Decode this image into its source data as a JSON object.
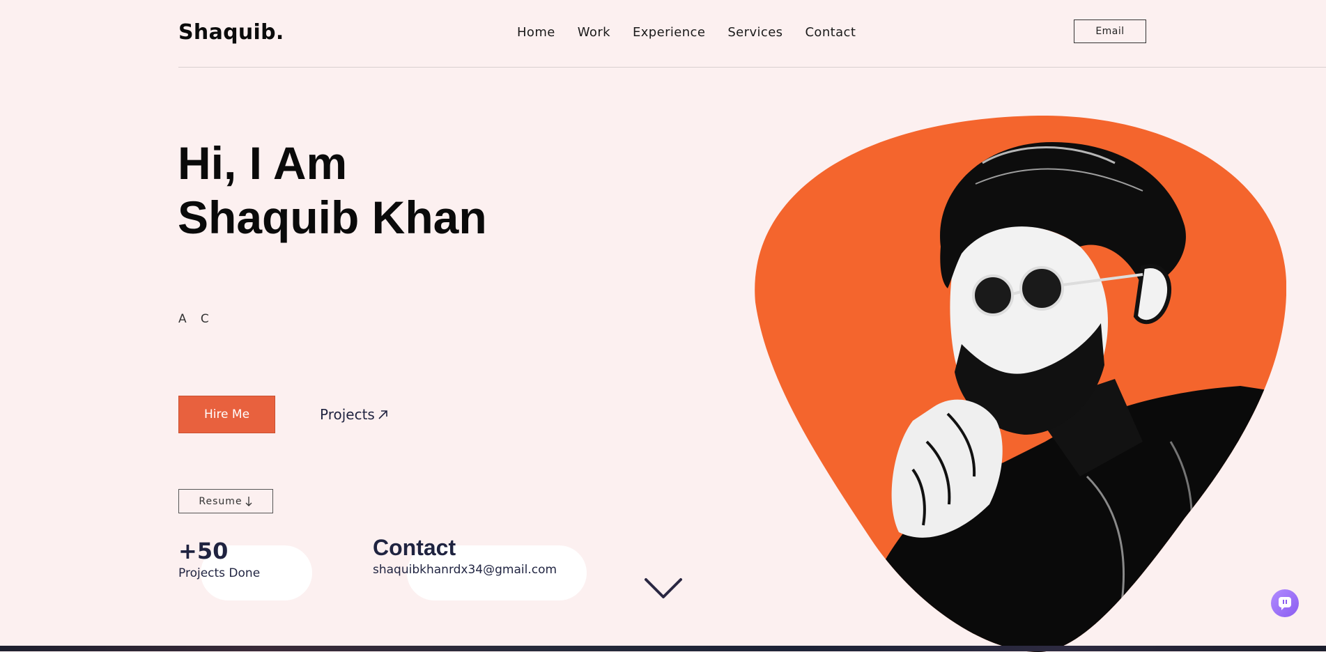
{
  "header": {
    "logo": "Shaquib.",
    "nav": [
      "Home",
      "Work",
      "Experience",
      "Services",
      "Contact"
    ],
    "email_button": "Email"
  },
  "hero": {
    "title_line1": "Hi, I Am",
    "title_line2": "Shaquib Khan",
    "typed_text": "A   C",
    "hire_button": "Hire Me",
    "projects_link": "Projects",
    "resume_button": "Resume"
  },
  "stats": {
    "projects_count": "+50",
    "projects_label": "Projects Done",
    "contact_title": "Contact",
    "contact_email": "shaquibkhanrdx34@gmail.com"
  },
  "colors": {
    "accent": "#e8613e",
    "portrait_bg": "#f4652d",
    "background": "#fcf0f0",
    "text_dark": "#1f2340"
  },
  "icons": {
    "projects_arrow": "arrow-up-right-icon",
    "resume_arrow": "arrow-down-icon",
    "scroll": "chevron-down-icon",
    "chat": "chat-icon"
  }
}
